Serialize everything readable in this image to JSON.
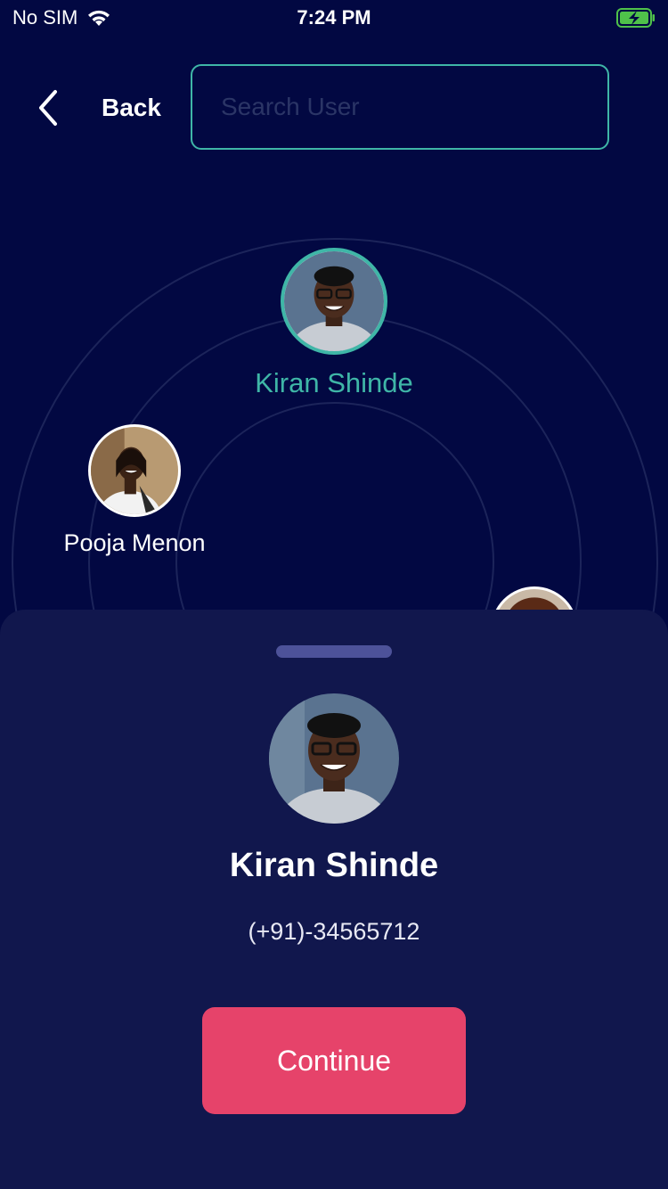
{
  "status_bar": {
    "carrier": "No SIM",
    "time": "7:24 PM"
  },
  "header": {
    "back_label": "Back",
    "search_placeholder": "Search User"
  },
  "radar_users": [
    {
      "name": "Kiran Shinde",
      "selected": true
    },
    {
      "name": "Pooja Menon",
      "selected": false
    }
  ],
  "selected_user": {
    "name": "Kiran Shinde",
    "phone": "(+91)-34565712"
  },
  "actions": {
    "continue_label": "Continue"
  },
  "colors": {
    "background": "#020842",
    "sheet": "#11174d",
    "accent": "#3fb6a7",
    "button": "#e6436a",
    "handle": "#4d5299"
  }
}
